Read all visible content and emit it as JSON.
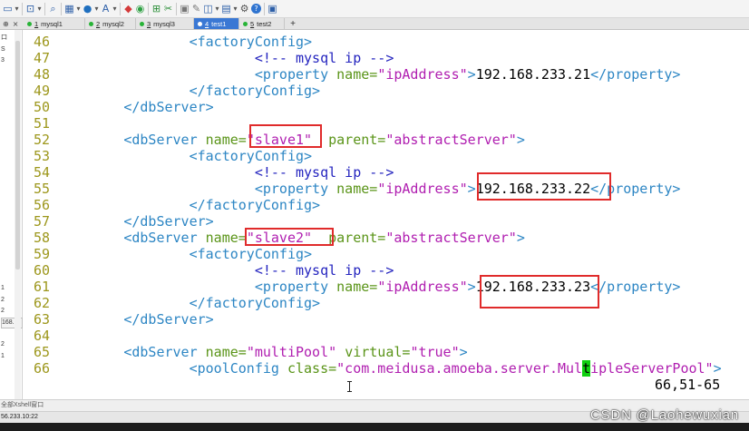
{
  "toolbar": {
    "items": [
      {
        "name": "new-session-icon",
        "glyph": "▭",
        "color": "#2d5fa8"
      },
      {
        "name": "dropdown-caret-icon",
        "glyph": "▾",
        "color": "#555555"
      },
      {
        "separator": true
      },
      {
        "name": "open-session-icon",
        "glyph": "⊡",
        "color": "#2d5fa8"
      },
      {
        "name": "dropdown-caret-icon",
        "glyph": "▾",
        "color": "#555555"
      },
      {
        "separator": true
      },
      {
        "name": "find-icon",
        "glyph": "⌕",
        "color": "#2d5fa8"
      },
      {
        "separator": true
      },
      {
        "name": "properties-icon",
        "glyph": "▦",
        "color": "#2d5fa8"
      },
      {
        "name": "dropdown-caret-icon",
        "glyph": "▾",
        "color": "#555555"
      },
      {
        "name": "color-scheme-icon",
        "glyph": "●",
        "color": "#1f6fbf"
      },
      {
        "name": "dropdown-caret-icon",
        "glyph": "▾",
        "color": "#555555"
      },
      {
        "name": "font-icon",
        "glyph": "A",
        "color": "#2d5fa8"
      },
      {
        "name": "dropdown-caret-icon",
        "glyph": "▾",
        "color": "#555555"
      },
      {
        "separator": true
      },
      {
        "name": "xftp-icon",
        "glyph": "◆",
        "color": "#d43a3a"
      },
      {
        "name": "xagent-icon",
        "glyph": "◉",
        "color": "#2ea043"
      },
      {
        "separator": true
      },
      {
        "name": "fullscreen-icon",
        "glyph": "⊞",
        "color": "#2d8f3a"
      },
      {
        "name": "cut-icon",
        "glyph": "✂",
        "color": "#2d8f3a"
      },
      {
        "separator": true
      },
      {
        "name": "lock-icon",
        "glyph": "▣",
        "color": "#777777"
      },
      {
        "name": "compose-icon",
        "glyph": "✎",
        "color": "#777777"
      },
      {
        "name": "layout-icon",
        "glyph": "◫",
        "color": "#2d5fa8"
      },
      {
        "name": "dropdown-caret-icon",
        "glyph": "▾",
        "color": "#555555"
      },
      {
        "name": "tile-icon",
        "glyph": "▤",
        "color": "#2d5fa8"
      },
      {
        "name": "dropdown-caret-icon",
        "glyph": "▾",
        "color": "#555555"
      },
      {
        "name": "settings-icon",
        "glyph": "⚙",
        "color": "#555555"
      },
      {
        "name": "help-icon",
        "glyph": "?",
        "color": "#ffffff"
      },
      {
        "separator": true
      },
      {
        "name": "tools-icon",
        "glyph": "▣",
        "color": "#2d5fa8"
      }
    ]
  },
  "tabs": {
    "panel_pin": "⊕",
    "panel_close": "×",
    "items": [
      {
        "num": "1",
        "label": "mysql1",
        "active": false
      },
      {
        "num": "2",
        "label": "mysql2",
        "active": false
      },
      {
        "num": "3",
        "label": "mysql3",
        "active": false
      },
      {
        "num": "4",
        "label": "test1",
        "active": true
      },
      {
        "num": "5",
        "label": "test2",
        "active": false
      }
    ],
    "add_label": "+"
  },
  "sidebar": {
    "top_items": [
      "口",
      "S",
      "3"
    ],
    "lower_items": [
      "1",
      "2",
      "2",
      "168..."
    ],
    "bottom_items": [
      "2",
      "1"
    ]
  },
  "terminal": {
    "lines": [
      {
        "num": "46",
        "tokens": [
          [
            "\t\t",
            ""
          ],
          [
            "<factoryConfig>",
            "t"
          ]
        ]
      },
      {
        "num": "47",
        "tokens": [
          [
            "\t\t\t",
            ""
          ],
          [
            "<!-- mysql ip -->",
            "c"
          ]
        ]
      },
      {
        "num": "48",
        "tokens": [
          [
            "\t\t\t",
            ""
          ],
          [
            "<property ",
            "t"
          ],
          [
            "name=",
            "a"
          ],
          [
            "\"ipAddress\"",
            "s"
          ],
          [
            ">",
            "t"
          ],
          [
            "192.168.233.21",
            "x"
          ],
          [
            "</property>",
            "t"
          ]
        ]
      },
      {
        "num": "49",
        "tokens": [
          [
            "\t\t",
            ""
          ],
          [
            "</factoryConfig>",
            "t"
          ]
        ]
      },
      {
        "num": "50",
        "tokens": [
          [
            "\t",
            ""
          ],
          [
            "</dbServer>",
            "t"
          ]
        ]
      },
      {
        "num": "51",
        "tokens": []
      },
      {
        "num": "52",
        "tokens": [
          [
            "\t",
            ""
          ],
          [
            "<dbServer ",
            "t"
          ],
          [
            "name=",
            "a"
          ],
          [
            "\"slave1\"",
            "s"
          ],
          [
            "  ",
            ""
          ],
          [
            "parent=",
            "a"
          ],
          [
            "\"abstractServer\"",
            "s"
          ],
          [
            ">",
            "t"
          ]
        ]
      },
      {
        "num": "53",
        "tokens": [
          [
            "\t\t",
            ""
          ],
          [
            "<factoryConfig>",
            "t"
          ]
        ]
      },
      {
        "num": "54",
        "tokens": [
          [
            "\t\t\t",
            ""
          ],
          [
            "<!-- mysql ip -->",
            "c"
          ]
        ]
      },
      {
        "num": "55",
        "tokens": [
          [
            "\t\t\t",
            ""
          ],
          [
            "<property ",
            "t"
          ],
          [
            "name=",
            "a"
          ],
          [
            "\"ipAddress\"",
            "s"
          ],
          [
            ">",
            "t"
          ],
          [
            "192.168.233.22",
            "x"
          ],
          [
            "</property>",
            "t"
          ]
        ]
      },
      {
        "num": "56",
        "tokens": [
          [
            "\t\t",
            ""
          ],
          [
            "</factoryConfig>",
            "t"
          ]
        ]
      },
      {
        "num": "57",
        "tokens": [
          [
            "\t",
            ""
          ],
          [
            "</dbServer>",
            "t"
          ]
        ]
      },
      {
        "num": "58",
        "tokens": [
          [
            "\t",
            ""
          ],
          [
            "<dbServer ",
            "t"
          ],
          [
            "name=",
            "a"
          ],
          [
            "\"slave2\"",
            "s"
          ],
          [
            "  ",
            ""
          ],
          [
            "parent=",
            "a"
          ],
          [
            "\"abstractServer\"",
            "s"
          ],
          [
            ">",
            "t"
          ]
        ]
      },
      {
        "num": "59",
        "tokens": [
          [
            "\t\t",
            ""
          ],
          [
            "<factoryConfig>",
            "t"
          ]
        ]
      },
      {
        "num": "60",
        "tokens": [
          [
            "\t\t\t",
            ""
          ],
          [
            "<!-- mysql ip -->",
            "c"
          ]
        ]
      },
      {
        "num": "61",
        "tokens": [
          [
            "\t\t\t",
            ""
          ],
          [
            "<property ",
            "t"
          ],
          [
            "name=",
            "a"
          ],
          [
            "\"ipAddress\"",
            "s"
          ],
          [
            ">",
            "t"
          ],
          [
            "192.168.233.23",
            "x"
          ],
          [
            "</property>",
            "t"
          ]
        ]
      },
      {
        "num": "62",
        "tokens": [
          [
            "\t\t",
            ""
          ],
          [
            "</factoryConfig>",
            "t"
          ]
        ]
      },
      {
        "num": "63",
        "tokens": [
          [
            "\t",
            ""
          ],
          [
            "</dbServer>",
            "t"
          ]
        ]
      },
      {
        "num": "64",
        "tokens": []
      },
      {
        "num": "65",
        "tokens": [
          [
            "\t",
            ""
          ],
          [
            "<dbServer ",
            "t"
          ],
          [
            "name=",
            "a"
          ],
          [
            "\"multiPool\"",
            "s"
          ],
          [
            " ",
            ""
          ],
          [
            "virtual=",
            "a"
          ],
          [
            "\"true\"",
            "s"
          ],
          [
            ">",
            "t"
          ]
        ]
      },
      {
        "num": "66",
        "tokens": [
          [
            "\t\t",
            ""
          ],
          [
            "<poolConfig ",
            "t"
          ],
          [
            "class=",
            "a"
          ],
          [
            "\"com.meidusa.amoeba.server.Mul",
            "s"
          ],
          [
            "t",
            "cur"
          ],
          [
            "ipleServerPool\"",
            "s"
          ],
          [
            ">",
            "t"
          ]
        ]
      }
    ],
    "ruler": "66,51-65"
  },
  "compose_bar": {
    "text": "全部Xshell窗口"
  },
  "statusbar": {
    "connection": "56.233.10:22"
  },
  "watermark": "CSDN @Laohewuxian",
  "colors": {
    "line_number": "#9d971c",
    "tag": "#2d86c4",
    "attribute": "#5a9418",
    "string": "#b01eb0",
    "comment": "#2424bf",
    "text": "#000000",
    "cursor": "#10d010",
    "annotation_box": "#e02b2b",
    "active_tab": "#3a78d4"
  }
}
